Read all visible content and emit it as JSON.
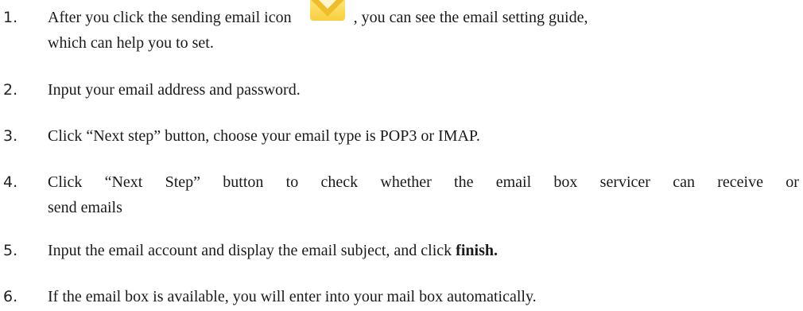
{
  "steps": [
    {
      "number": "1.",
      "line1_before": "After you click the sending email icon",
      "icon": "mail-envelope-icon",
      "line1_after": ", you can see the email setting guide,",
      "line2": "which can help you to set."
    },
    {
      "number": "2.",
      "text": "Input your email address and password."
    },
    {
      "number": "3.",
      "text": "Click “Next step” button, choose your email type is POP3 or IMAP."
    },
    {
      "number": "4.",
      "line1_words": [
        "Click",
        "“Next",
        "Step”",
        "button",
        "to",
        "check",
        "whether",
        "the",
        "email",
        "box",
        "servicer",
        "can",
        "receive",
        "or"
      ],
      "line2": "send emails"
    },
    {
      "number": "5.",
      "text_before": "Input the email account and display the email subject, and click",
      "bold": "finish."
    },
    {
      "number": "6.",
      "text": "If the email box is available, you will enter into your mail box automatically."
    }
  ],
  "colors": {
    "icon_light": "#fde47a",
    "icon_dark": "#f0bd2a",
    "text": "#1a1a1a"
  }
}
